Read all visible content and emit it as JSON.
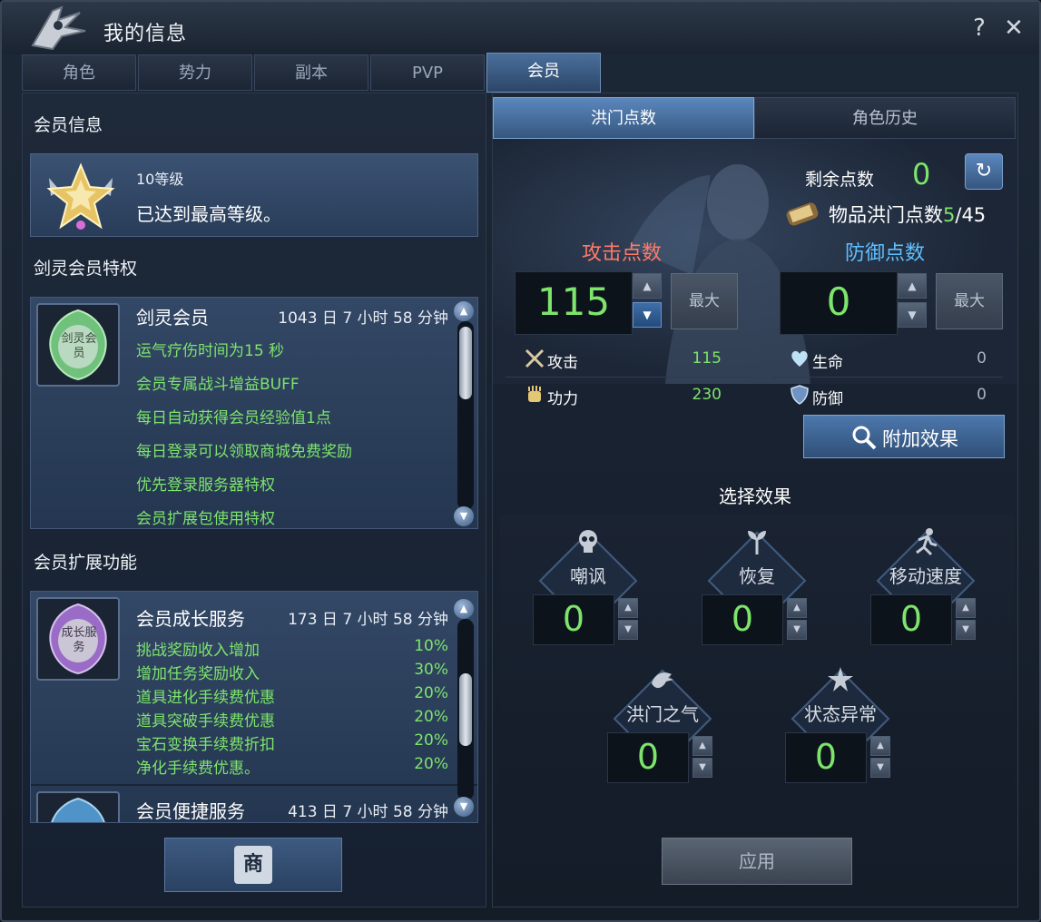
{
  "window": {
    "title": "我的信息",
    "help": "?",
    "close": "✕"
  },
  "tabs": [
    "角色",
    "势力",
    "副本",
    "PVP",
    "会员"
  ],
  "left": {
    "member_info_title": "会员信息",
    "level": "10等级",
    "max_level_text": "已达到最高等级。",
    "privilege_title": "剑灵会员特权",
    "privilege": {
      "name": "剑灵会员",
      "time": "1043 日 7 小时 58 分钟",
      "gem_text": "剑灵会员",
      "perks": [
        "运气疗伤时间为15 秒",
        "会员专属战斗增益BUFF",
        "每日自动获得会员经验值1点",
        "每日登录可以领取商城免费奖励",
        "优先登录服务器特权",
        "会员扩展包使用特权"
      ]
    },
    "extension_title": "会员扩展功能",
    "growth": {
      "name": "会员成长服务",
      "time": "173 日 7 小时 58 分钟",
      "gem_text": "成长服务",
      "perks": [
        {
          "label": "挑战奖励收入增加",
          "value": "10%"
        },
        {
          "label": "增加任务奖励收入",
          "value": "30%"
        },
        {
          "label": "道具进化手续费优惠",
          "value": "20%"
        },
        {
          "label": "道具突破手续费优惠",
          "value": "20%"
        },
        {
          "label": "宝石变换手续费折扣",
          "value": "20%"
        },
        {
          "label": "净化手续费优惠。",
          "value": "20%"
        }
      ]
    },
    "convenience": {
      "name": "会员便捷服务",
      "time": "413 日 7 小时 58 分钟"
    },
    "shop_button_glyph": "商"
  },
  "right": {
    "subtabs": [
      "洪门点数",
      "角色历史"
    ],
    "remaining_label": "剩余点数",
    "remaining_value": "0",
    "refresh_glyph": "↻",
    "item_points_label": "物品洪门点数",
    "item_points_current": "5",
    "item_points_total": "/45",
    "attack_title": "攻击点数",
    "defense_title": "防御点数",
    "attack_value": "115",
    "defense_value": "0",
    "max_label": "最大",
    "stats": [
      {
        "label": "攻击",
        "value": "115",
        "color": "#7de46c",
        "icon": "crossed-swords-icon"
      },
      {
        "label": "生命",
        "value": "0",
        "color": "#aab3bf",
        "icon": "heart-icon"
      },
      {
        "label": "功力",
        "value": "230",
        "color": "#7de46c",
        "icon": "fist-icon"
      },
      {
        "label": "防御",
        "value": "0",
        "color": "#aab3bf",
        "icon": "shield-icon"
      }
    ],
    "effect_button": "附加效果",
    "select_title": "选择效果",
    "effects": [
      {
        "name": "嘲讽",
        "value": "0",
        "icon": "skull-icon"
      },
      {
        "name": "恢复",
        "value": "0",
        "icon": "sprout-icon"
      },
      {
        "name": "移动速度",
        "value": "0",
        "icon": "running-man-icon"
      },
      {
        "name": "洪门之气",
        "value": "0",
        "icon": "dragon-icon"
      },
      {
        "name": "状态异常",
        "value": "0",
        "icon": "star-burst-icon"
      }
    ],
    "apply_button": "应用"
  },
  "colors": {
    "green_value": "#7de46c",
    "attack_red": "#ff7a66",
    "defense_blue": "#5ec0ff",
    "accent_blue": "#4d78ac"
  }
}
